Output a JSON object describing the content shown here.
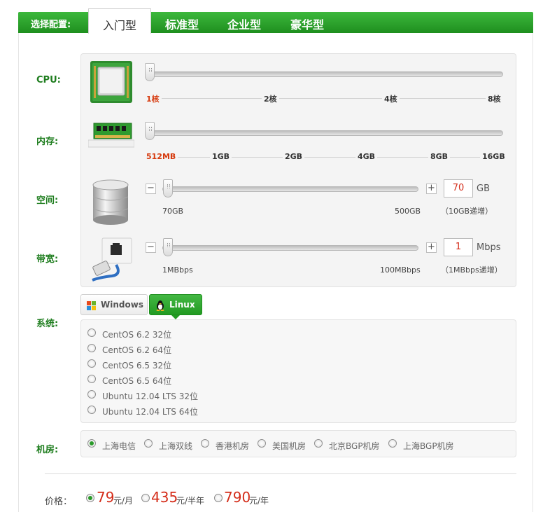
{
  "tabs": {
    "label": "选择配置:",
    "items": [
      "入门型",
      "标准型",
      "企业型",
      "豪华型"
    ],
    "active": 0
  },
  "rows": {
    "cpu": "CPU:",
    "mem": "内存:",
    "disk": "空间:",
    "bw": "带宽:",
    "os": "系统:",
    "room": "机房:"
  },
  "cpu": {
    "ticks": [
      "1核",
      "2核",
      "4核",
      "8核"
    ],
    "selected": "1核"
  },
  "mem": {
    "ticks": [
      "512MB",
      "1GB",
      "2GB",
      "4GB",
      "8GB",
      "16GB"
    ],
    "selected": "512MB"
  },
  "disk": {
    "minus": "−",
    "plus": "+",
    "value": "70",
    "unit": "GB",
    "min": "70GB",
    "max": "500GB",
    "step": "（10GB递增）",
    "level": 0.0
  },
  "bandwidth": {
    "minus": "−",
    "plus": "+",
    "value": "1",
    "unit": "Mbps",
    "min": "1MBbps",
    "max": "100MBbps",
    "step": "（1MBbps递增）",
    "level": 0.0
  },
  "os": {
    "tabs": {
      "windows": "Windows",
      "linux": "Linux"
    },
    "active_tab": "linux",
    "options": [
      "CentOS 6.2 32位",
      "CentOS 6.2 64位",
      "CentOS 6.5 32位",
      "CentOS 6.5 64位",
      "Ubuntu 12.04 LTS 32位",
      "Ubuntu 12.04 LTS 64位"
    ]
  },
  "rooms": {
    "options": [
      "上海电信",
      "上海双线",
      "香港机房",
      "美国机房",
      "北京BGP机房",
      "上海BGP机房"
    ],
    "selected": 0
  },
  "price": {
    "label": "价格：",
    "options": [
      {
        "amount": "79",
        "unit": "元/月"
      },
      {
        "amount": "435",
        "unit": "元/半年"
      },
      {
        "amount": "790",
        "unit": "元/年"
      }
    ],
    "selected": 0
  },
  "colors": {
    "brand": "#1e8f1e",
    "accent_red": "#d42d1a"
  }
}
